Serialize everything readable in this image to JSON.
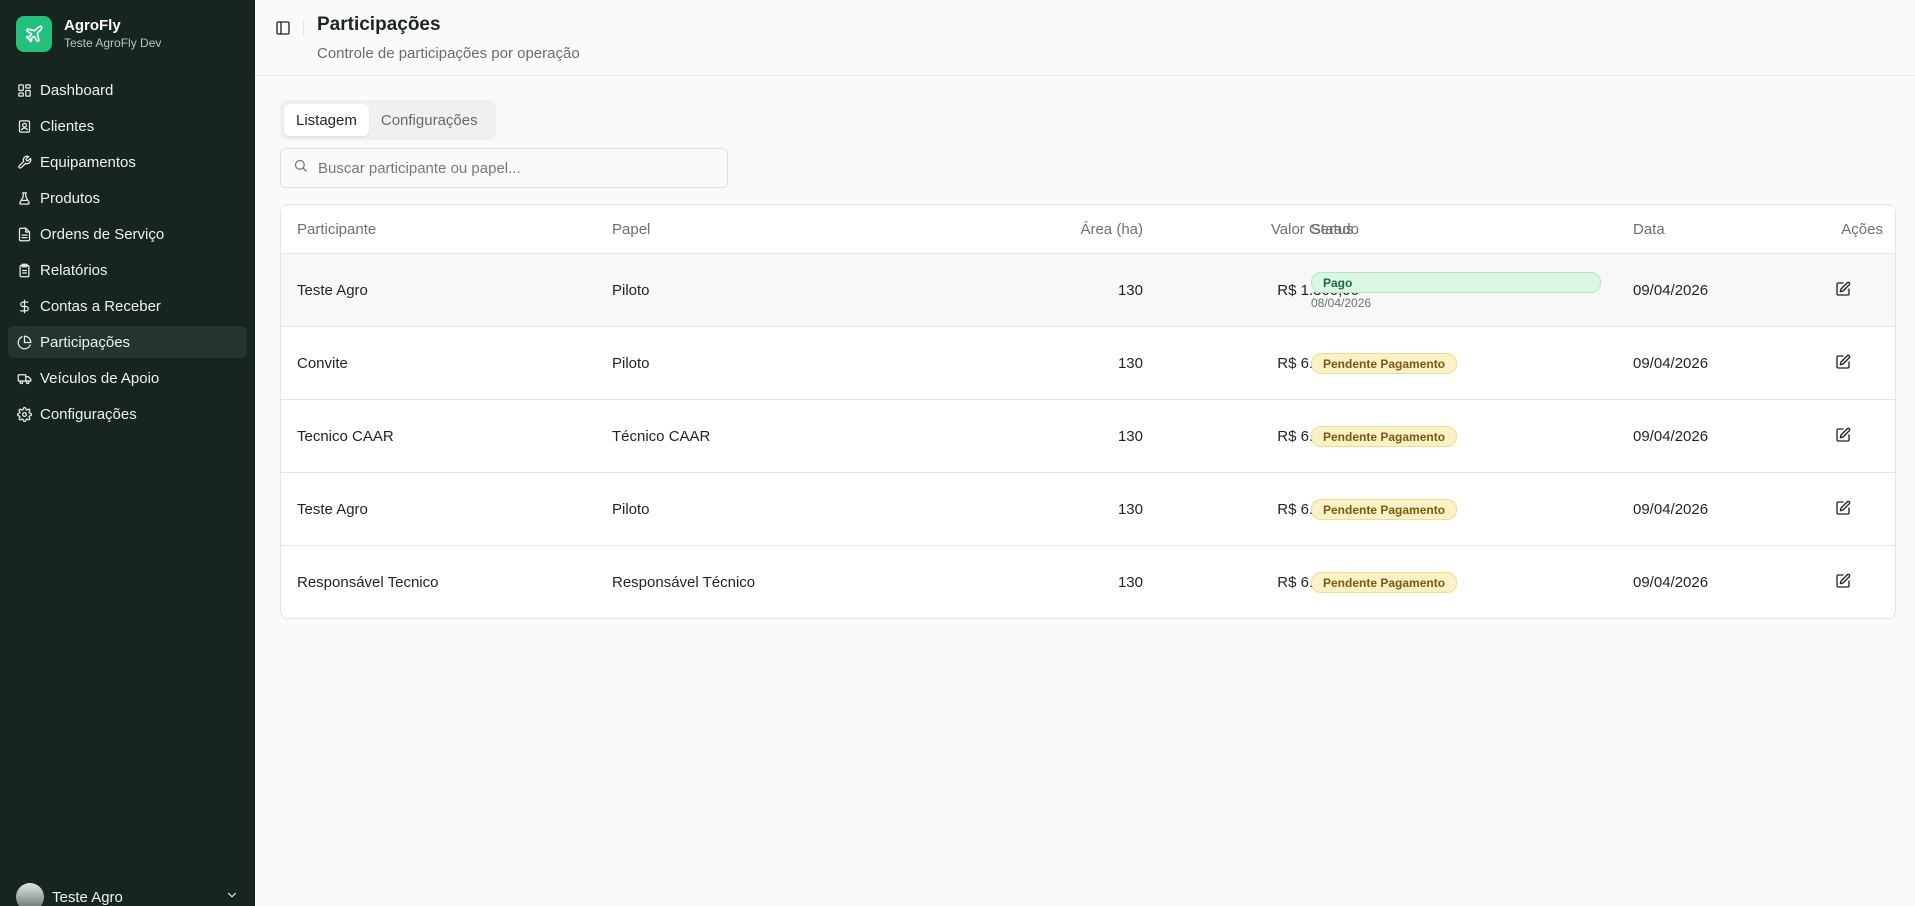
{
  "app": {
    "name": "AgroFly",
    "workspace": "Teste AgroFly Dev",
    "accent": "#22c07a",
    "sidebar_bg": "#16251f"
  },
  "sidebar": {
    "items": [
      {
        "label": "Dashboard",
        "icon": "grid-icon"
      },
      {
        "label": "Clientes",
        "icon": "contacts-icon"
      },
      {
        "label": "Equipamentos",
        "icon": "wrench-icon"
      },
      {
        "label": "Produtos",
        "icon": "flask-icon"
      },
      {
        "label": "Ordens de Serviço",
        "icon": "file-icon"
      },
      {
        "label": "Relatórios",
        "icon": "clipboard-icon"
      },
      {
        "label": "Contas a Receber",
        "icon": "dollar-icon"
      },
      {
        "label": "Participações",
        "icon": "pie-chart-icon",
        "active": true
      },
      {
        "label": "Veículos de Apoio",
        "icon": "truck-icon"
      },
      {
        "label": "Configurações",
        "icon": "gear-icon"
      }
    ],
    "user": {
      "name": "Teste Agro"
    }
  },
  "header": {
    "title": "Participações",
    "subtitle": "Controle de participações por operação"
  },
  "tabs": [
    {
      "label": "Listagem",
      "active": true
    },
    {
      "label": "Configurações",
      "active": false
    }
  ],
  "search": {
    "placeholder": "Buscar participante ou papel...",
    "value": ""
  },
  "table": {
    "columns": {
      "participante": "Participante",
      "papel": "Papel",
      "area": "Área (ha)",
      "valor": "Valor Gerado",
      "status": "Status",
      "data": "Data",
      "acoes": "Ações"
    },
    "rows": [
      {
        "participante": "Teste Agro",
        "papel": "Piloto",
        "area": "130",
        "valor": "R$ 1.300,00",
        "status": "Pago",
        "status_date": "08/04/2026",
        "data": "09/04/2026"
      },
      {
        "participante": "Convite",
        "papel": "Piloto",
        "area": "130",
        "valor": "R$ 6.500,00",
        "status": "Pendente Pagamento",
        "status_date": "",
        "data": "09/04/2026"
      },
      {
        "participante": "Tecnico CAAR",
        "papel": "Técnico CAAR",
        "area": "130",
        "valor": "R$ 6.500,00",
        "status": "Pendente Pagamento",
        "status_date": "",
        "data": "09/04/2026"
      },
      {
        "participante": "Teste Agro",
        "papel": "Piloto",
        "area": "130",
        "valor": "R$ 6.500,00",
        "status": "Pendente Pagamento",
        "status_date": "",
        "data": "09/04/2026"
      },
      {
        "participante": "Responsável Tecnico",
        "papel": "Responsável Técnico",
        "area": "130",
        "valor": "R$ 6.500,00",
        "status": "Pendente Pagamento",
        "status_date": "",
        "data": "09/04/2026"
      }
    ]
  },
  "status_colors": {
    "paid_bg": "#d9f7e4",
    "paid_text": "#1c6b3a",
    "pending_bg": "#fbf1c7",
    "pending_text": "#7a5a10"
  }
}
